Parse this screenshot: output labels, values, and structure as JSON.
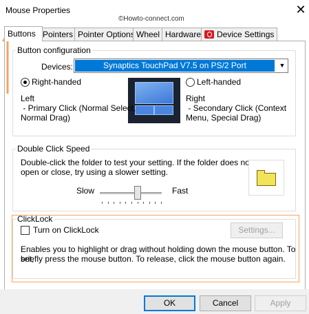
{
  "window": {
    "title": "Mouse Properties",
    "watermark": "©Howto-connect.com"
  },
  "tabs": [
    {
      "label": "Buttons",
      "active": true
    },
    {
      "label": "Pointers"
    },
    {
      "label": "Pointer Options"
    },
    {
      "label": "Wheel"
    },
    {
      "label": "Hardware"
    },
    {
      "label": "Device Settings",
      "icon": "synaptics-icon"
    }
  ],
  "button_configuration": {
    "legend": "Button configuration",
    "devices_label": "Devices:",
    "devices_value": "Synaptics TouchPad V7.5 on PS/2 Port",
    "right_handed": {
      "label": "Right-handed",
      "selected": true
    },
    "left_handed": {
      "label": "Left-handed",
      "selected": false
    },
    "left_desc_title": "Left",
    "left_desc_1": " - Primary Click (Normal Select,",
    "left_desc_2": "Normal Drag)",
    "right_desc_title": "Right",
    "right_desc_1": " - Secondary Click (Context",
    "right_desc_2": "Menu, Special Drag)"
  },
  "double_click": {
    "legend": "Double Click Speed",
    "text_1": "Double-click the folder to test your setting.  If the folder does not",
    "text_2": "open or close, try using a slower setting.",
    "slow": "Slow",
    "fast": "Fast",
    "speed_position": 0.6
  },
  "clicklock": {
    "legend": "ClickLock",
    "checkbox_label": "Turn on ClickLock",
    "checked": false,
    "settings_button": "Settings...",
    "text_1": "Enables you to highlight or drag without holding down the mouse button.  To set,",
    "text_2": "briefly press the mouse button.  To release, click the mouse button again."
  },
  "footer": {
    "ok": "OK",
    "cancel": "Cancel",
    "apply": "Apply"
  },
  "colors": {
    "selection": "#0078d7",
    "highlight": "#f4a460"
  }
}
